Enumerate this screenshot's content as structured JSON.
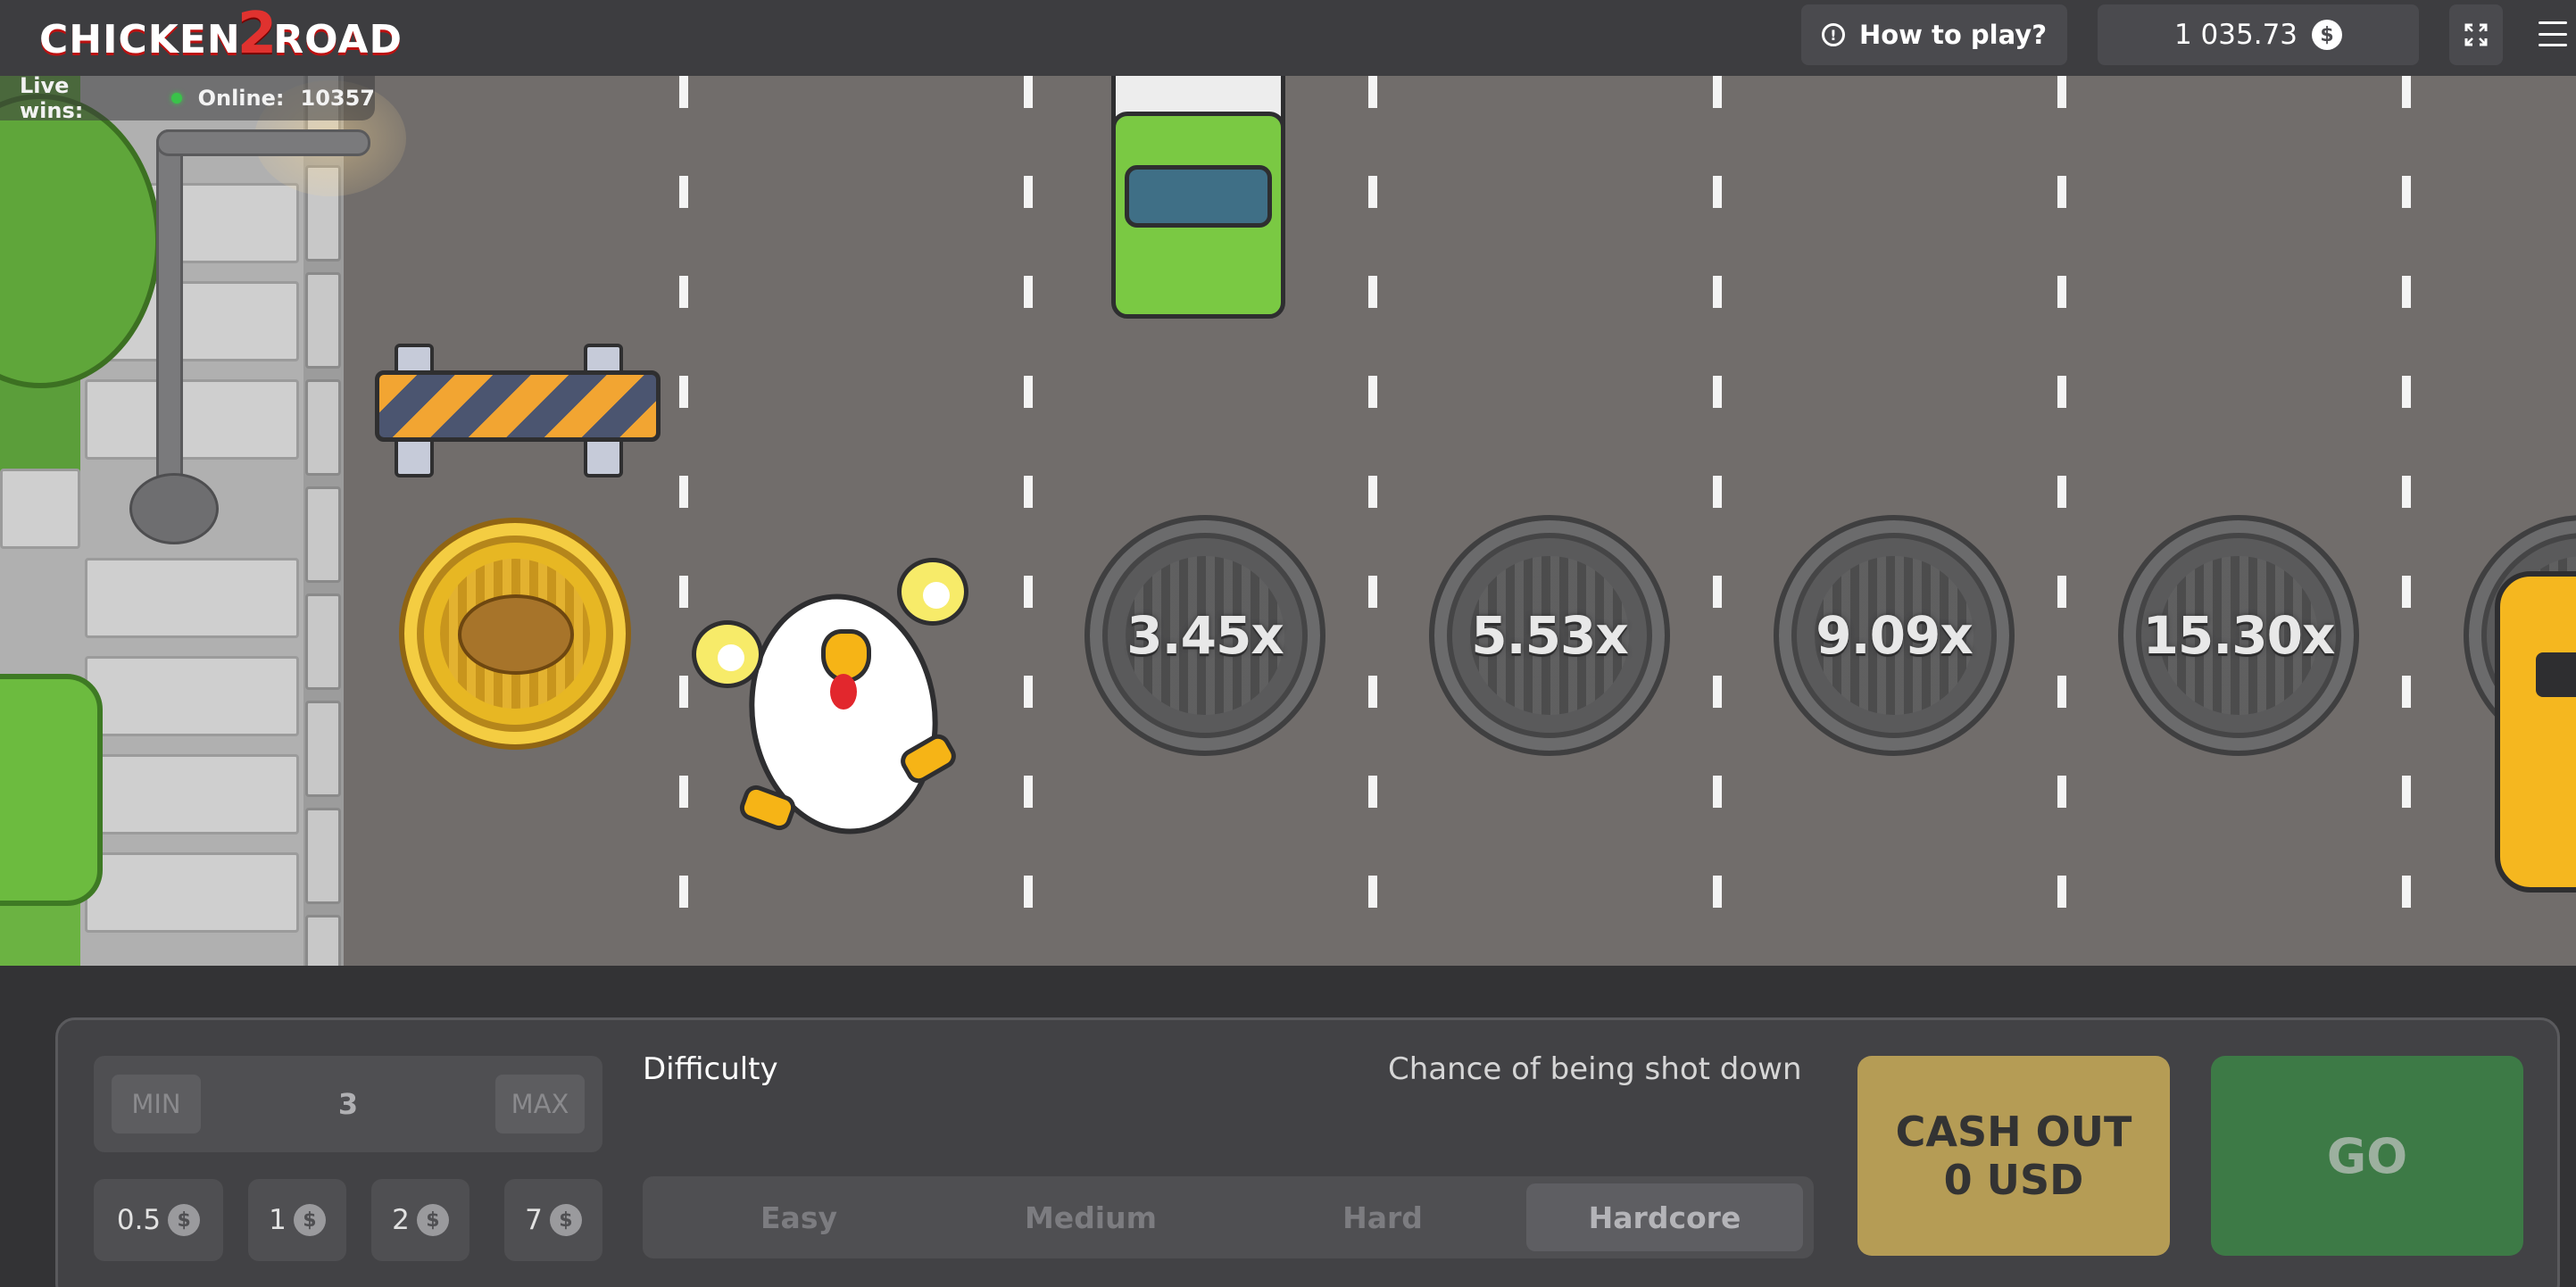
{
  "header": {
    "logo": "CHICKEN 2 ROAD",
    "logo_part1": "CHICKEN",
    "logo_part2": "2",
    "logo_part3": "ROAD",
    "how_to_play": "How to play?",
    "balance": "1 035.73",
    "currency_symbol": "$"
  },
  "status": {
    "live_wins_label": "Live wins:",
    "online_label": "Online:",
    "online_count": "10357"
  },
  "road": {
    "multipliers": [
      "3.45x",
      "5.53x",
      "9.09x",
      "15.30x"
    ]
  },
  "bet": {
    "min_label": "MIN",
    "max_label": "MAX",
    "value": "3",
    "quick_bets": [
      "0.5",
      "1",
      "2",
      "7"
    ]
  },
  "difficulty": {
    "label": "Difficulty",
    "chance_label": "Chance of being shot down",
    "options": [
      "Easy",
      "Medium",
      "Hard",
      "Hardcore"
    ],
    "selected": "Hardcore"
  },
  "actions": {
    "cashout_line1": "CASH OUT",
    "cashout_line2": "0 USD",
    "go": "GO"
  },
  "colors": {
    "road": "#716d6b",
    "cashout": "#b59c55",
    "go": "#3d7a46"
  },
  "icons": {
    "info": "info-icon",
    "coin": "dollar-coin-icon",
    "fullscreen": "fullscreen-icon",
    "menu": "hamburger-menu-icon"
  }
}
